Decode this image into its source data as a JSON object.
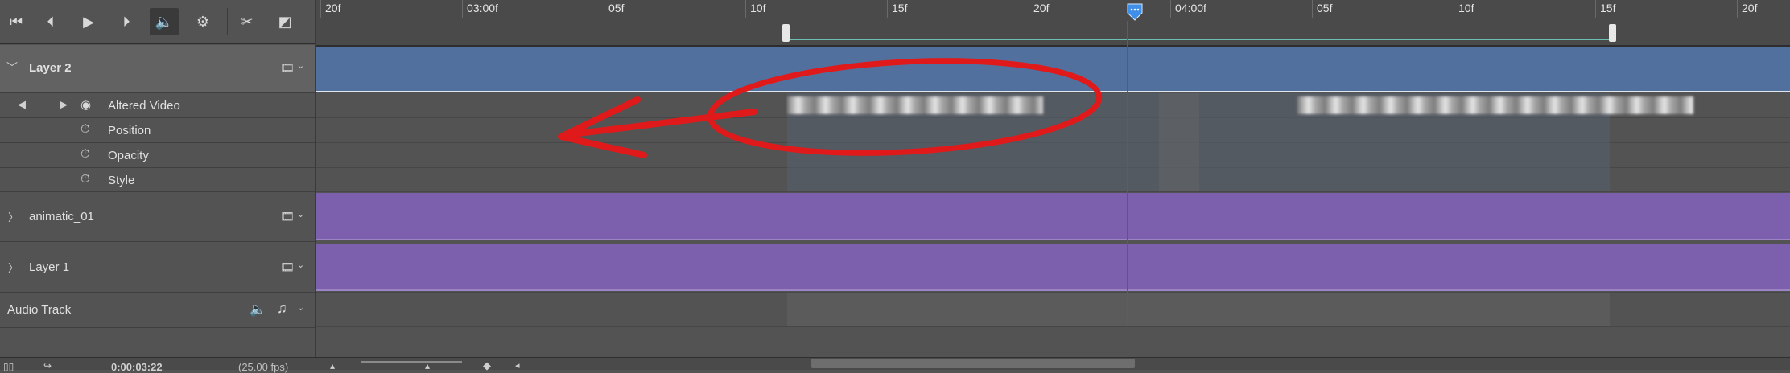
{
  "toolbar": {
    "buttons": [
      {
        "name": "go-to-first-frame-button",
        "glyph": "⏮"
      },
      {
        "name": "previous-frame-button",
        "glyph": "⏪"
      },
      {
        "name": "play-button",
        "glyph": "▶"
      },
      {
        "name": "next-frame-button",
        "glyph": "⏩"
      },
      {
        "name": "mute-audio-button",
        "glyph": "🔈"
      },
      {
        "name": "settings-button",
        "glyph": "⚙"
      },
      {
        "name": "split-at-playhead-button",
        "glyph": "✂"
      },
      {
        "name": "transition-button",
        "glyph": "◩"
      }
    ]
  },
  "tracks": {
    "layer2": {
      "label": "Layer 2"
    },
    "altered_video": {
      "label": "Altered Video"
    },
    "position": {
      "label": "Position"
    },
    "opacity": {
      "label": "Opacity"
    },
    "style": {
      "label": "Style"
    },
    "animatic": {
      "label": "animatic_01"
    },
    "layer1": {
      "label": "Layer 1"
    },
    "audio": {
      "label": "Audio Track"
    }
  },
  "ruler": {
    "labels": [
      "20f",
      "03:00f",
      "05f",
      "10f",
      "15f",
      "20f",
      "04:00f",
      "05f",
      "10f",
      "15f",
      "20f"
    ]
  },
  "bottom": {
    "timecode": "0:00:03:22",
    "fps": "(25.00 fps)"
  },
  "colors": {
    "layer2_clip": "#52709e",
    "purple_clip": "#7c60ad",
    "playhead": "#c9302c",
    "annotation": "#e01a1a",
    "work_area_bar": "#6dbfb4"
  }
}
